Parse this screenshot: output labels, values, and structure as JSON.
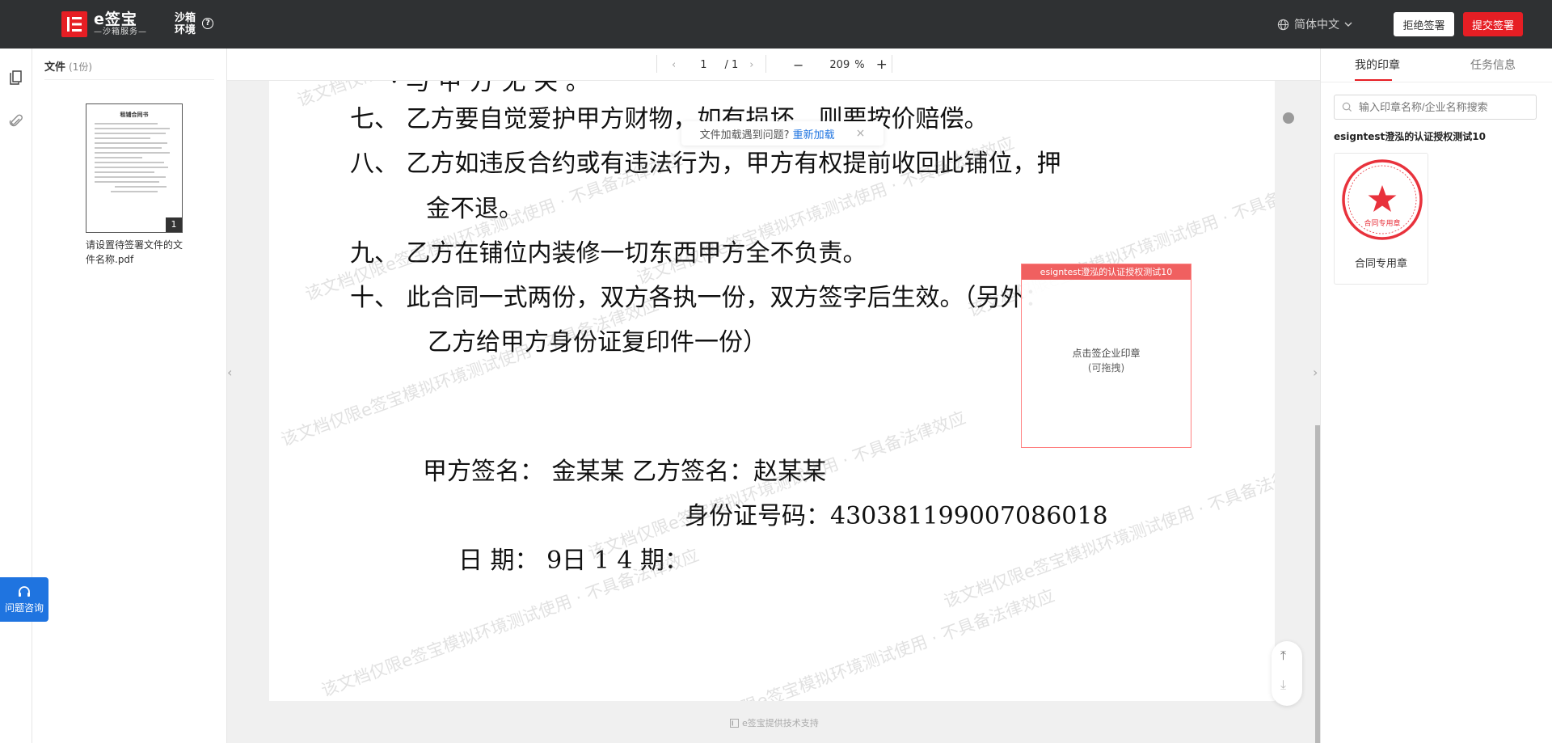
{
  "header": {
    "logo_main": "e签宝",
    "logo_sub": "—沙箱服务—",
    "env_line1": "沙箱",
    "env_line2": "环境",
    "language": "简体中文",
    "reject_label": "拒绝签署",
    "submit_label": "提交签署"
  },
  "file_panel": {
    "title": "文件",
    "count": "(1份)",
    "thumb_title": "租铺合同书",
    "thumb_page": "1",
    "file_name": "请设置待签署文件的文件名称.pdf"
  },
  "toolbar": {
    "current_page": "1",
    "total_pages": "/ 1",
    "zoom": "209",
    "zoom_unit": "%",
    "minus": "−",
    "plus": "+"
  },
  "notice": {
    "text": "文件加载遇到问题?",
    "link": "重新加载",
    "close": "×"
  },
  "document": {
    "lines": [
      "七、  乙方要自觉爱护甲方财物，如有损坏，则要按价赔偿。",
      "八、  乙方如违反合约或有违法行为，甲方有权提前收回此铺位，押",
      "金不退。",
      "九、  乙方在铺位内装修一切东西甲方全不负责。",
      "十、  此合同一式两份，双方各执一份，双方签字后生效。（另外：",
      "乙方给甲方身份证复印件一份）",
      "甲方签名：   金某某     乙方签名：赵某某",
      "身份证号码：430381199007086018",
      "日    期：         9日    1 4 期："
    ],
    "watermark": "该文档仅限e签宝模拟环境测试使用 · 不具备法律效应"
  },
  "seal_box": {
    "header": "esigntest澄泓的认证授权测试10",
    "line1": "点击签企业印章",
    "line2": "(可拖拽)"
  },
  "footer": {
    "text": "e签宝提供技术支持"
  },
  "right_panel": {
    "tab_seals": "我的印章",
    "tab_task": "任务信息",
    "search_placeholder": "输入印章名称/企业名称搜索",
    "company": "esigntest澄泓的认证授权测试10",
    "seal_name": "合同专用章",
    "seal_color": "#e8323c"
  },
  "help": {
    "label": "问题咨询"
  }
}
